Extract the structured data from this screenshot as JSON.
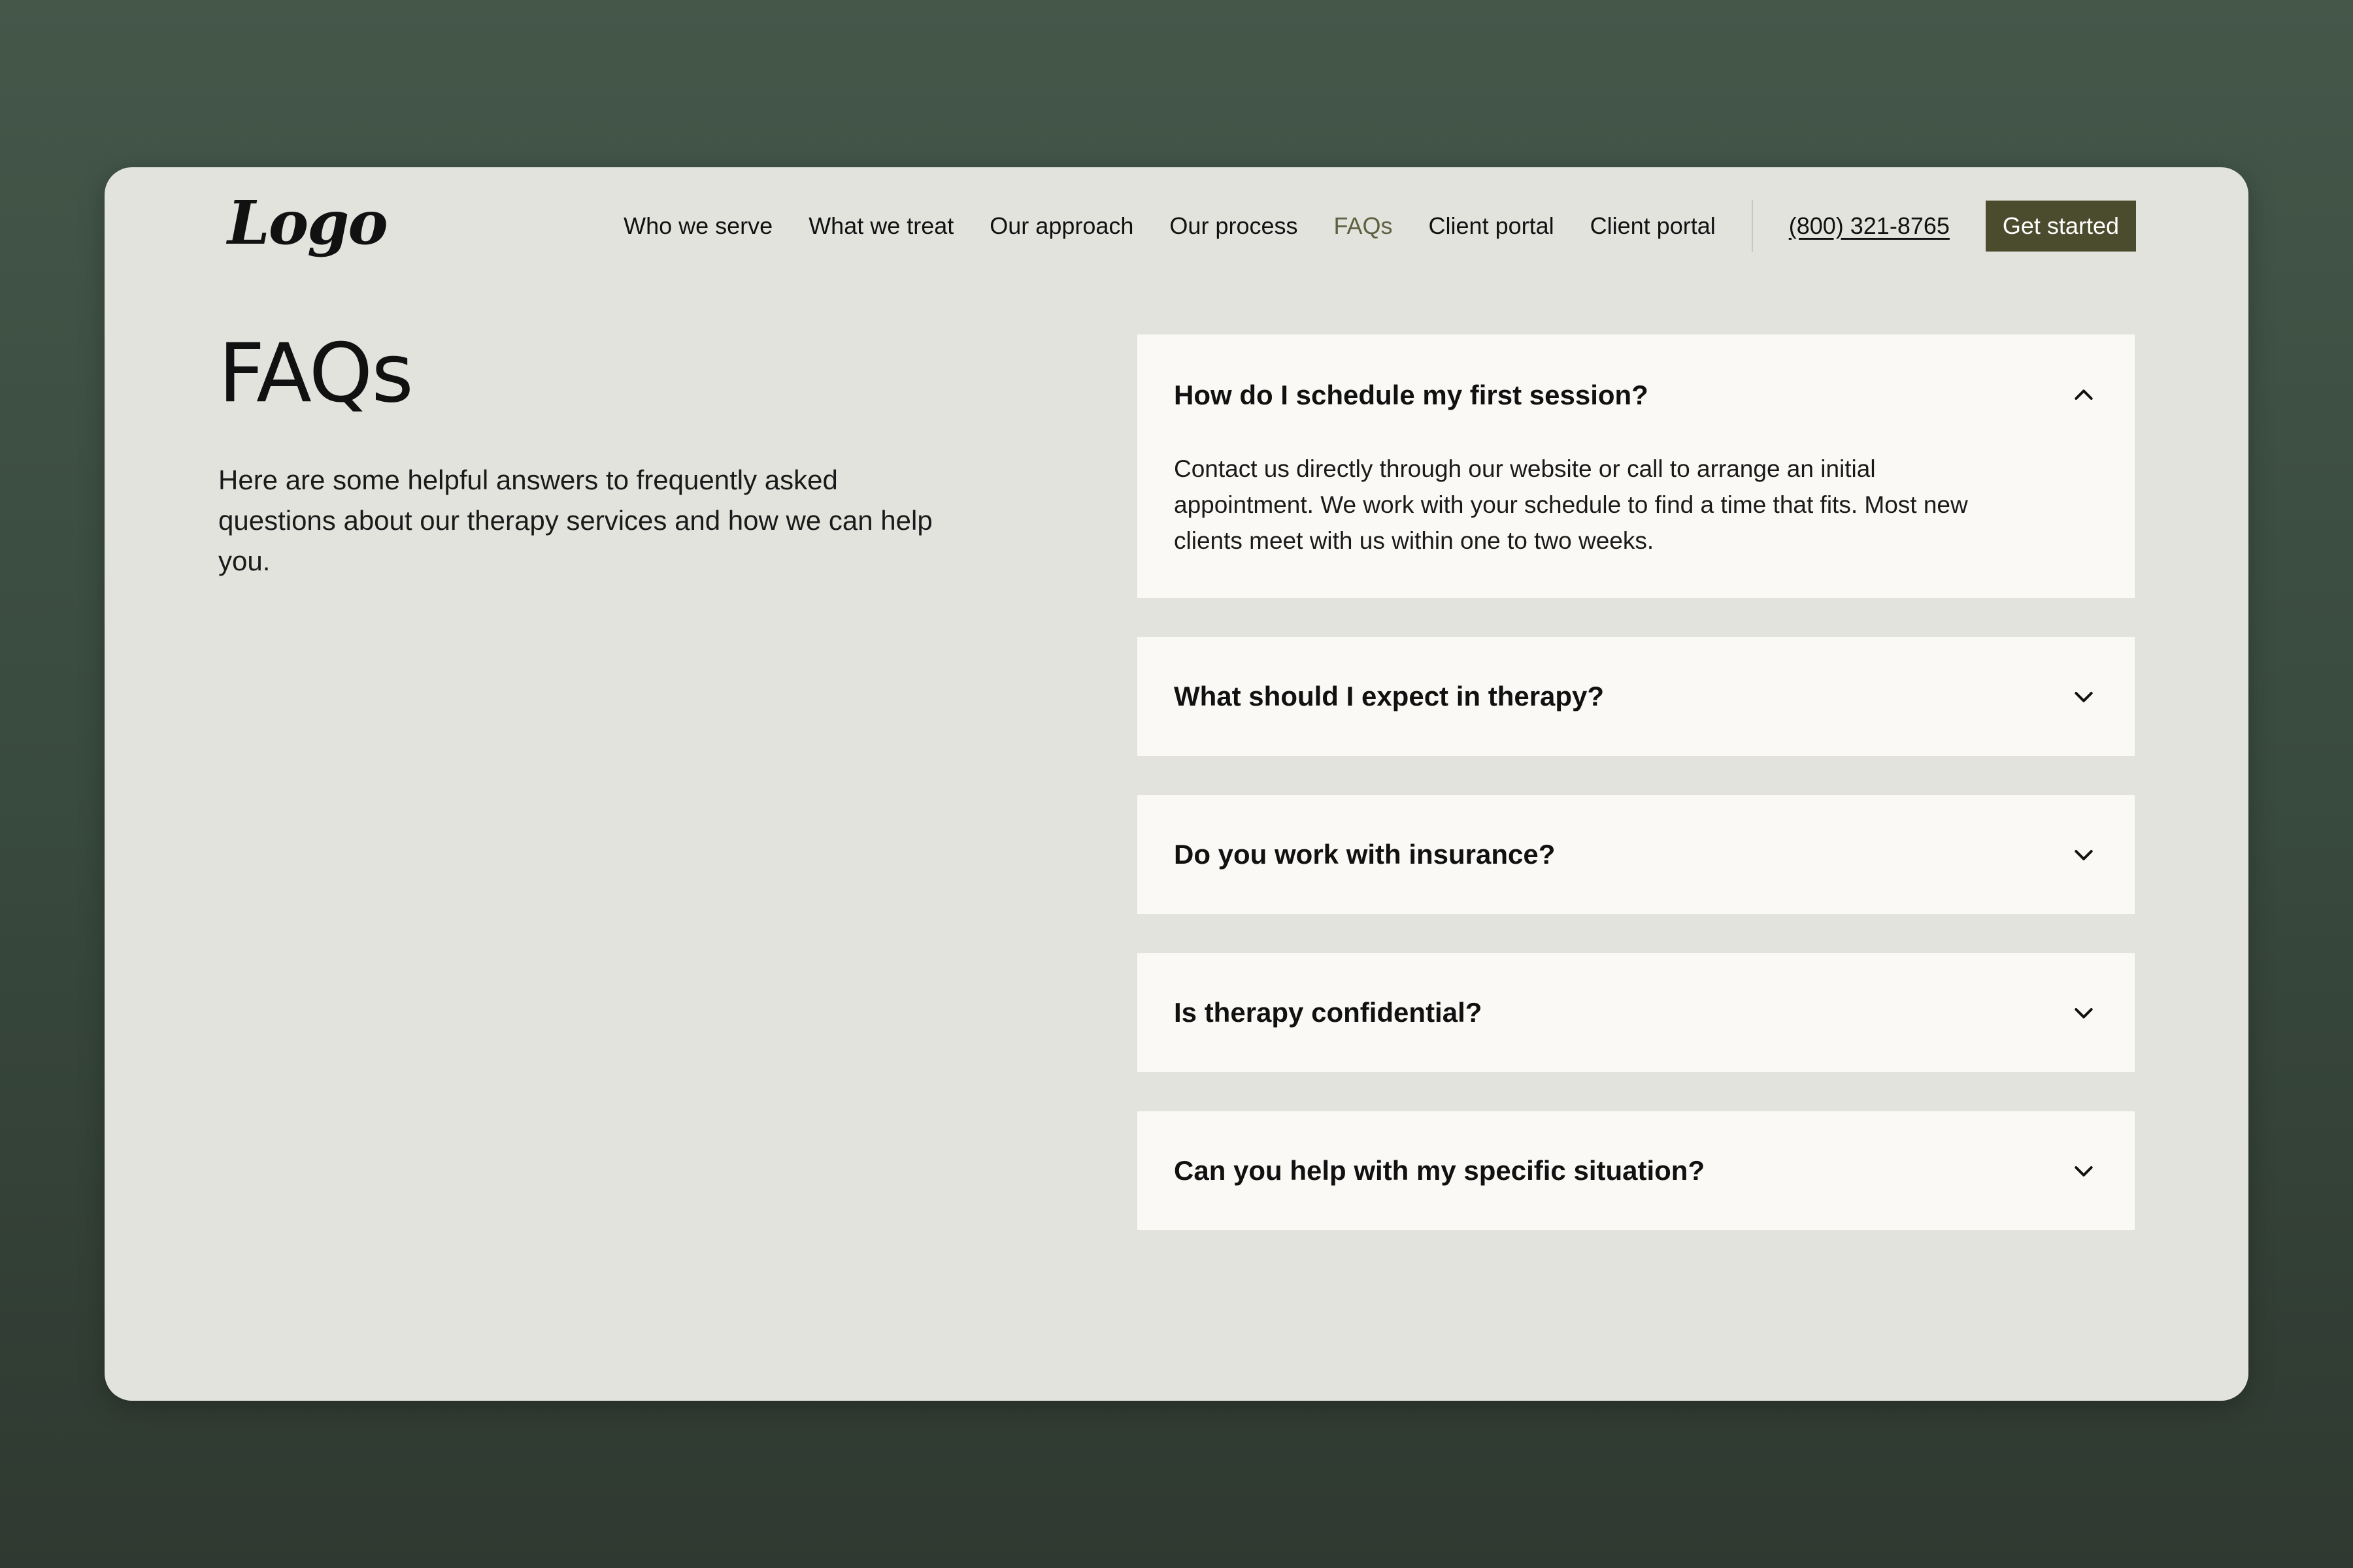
{
  "header": {
    "logo_text": "Logo",
    "nav": [
      {
        "label": "Who we serve",
        "active": false
      },
      {
        "label": "What we treat",
        "active": false
      },
      {
        "label": "Our approach",
        "active": false
      },
      {
        "label": "Our process",
        "active": false
      },
      {
        "label": "FAQs",
        "active": true
      },
      {
        "label": "Client portal",
        "active": false
      },
      {
        "label": "Client portal",
        "active": false
      }
    ],
    "phone": "(800) 321-8765",
    "cta_label": "Get started"
  },
  "intro": {
    "title": "FAQs",
    "description": "Here are some helpful answers to frequently asked questions about our therapy services and how we can help you."
  },
  "faqs": [
    {
      "question": "How do I schedule my first session?",
      "answer": "Contact us directly through our website or call to arrange an initial appointment. We work with your schedule to find a time that fits. Most new clients meet with us within one to two weeks.",
      "expanded": true,
      "icon": "chevron-up-icon"
    },
    {
      "question": "What should I expect in therapy?",
      "expanded": false,
      "icon": "chevron-down-icon"
    },
    {
      "question": "Do you work with insurance?",
      "expanded": false,
      "icon": "chevron-down-icon"
    },
    {
      "question": "Is therapy confidential?",
      "expanded": false,
      "icon": "chevron-down-icon"
    },
    {
      "question": "Can you help with my specific situation?",
      "expanded": false,
      "icon": "chevron-down-icon"
    }
  ],
  "colors": {
    "background_top": "#445749",
    "background_bottom": "#2f3931",
    "card": "#e3e3de",
    "faq_item": "#faf9f6",
    "accent": "#4b4b2d",
    "nav_active": "#5e6041"
  }
}
